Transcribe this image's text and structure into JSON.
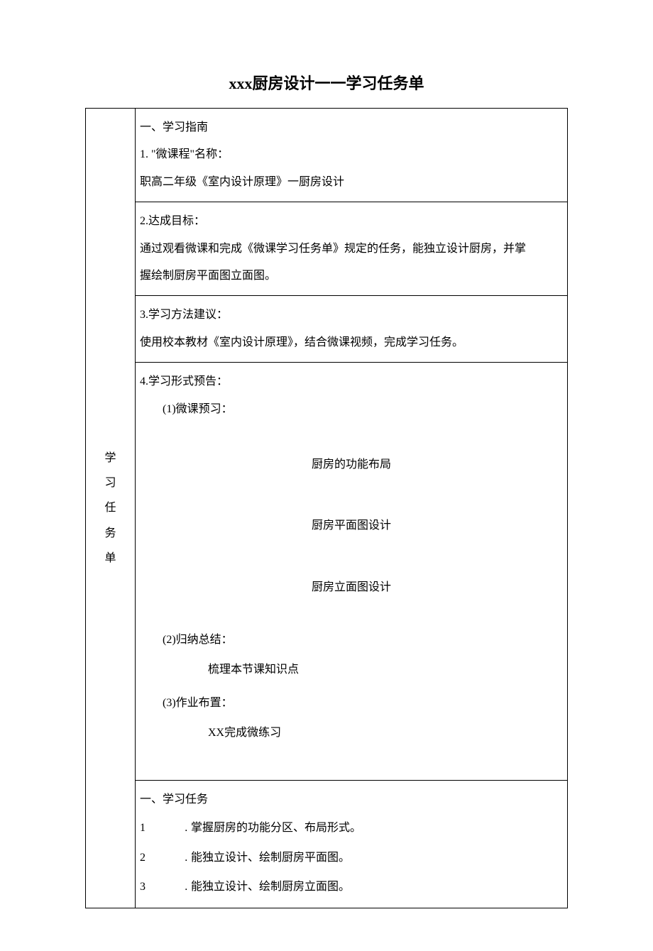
{
  "title": "xxx厨房设计一一学习任务单",
  "leftLabel": {
    "c1": "学",
    "c2": "习",
    "c3": "任",
    "c4": "务",
    "c5": "单"
  },
  "guide": {
    "heading": "一、学习指南",
    "item1_label": "1. \"微课程\"名称：",
    "item1_body": "职高二年级《室内设计原理》一厨房设计",
    "item2_label": "2.达成目标：",
    "item2_body_l1": "通过观看微课和完成《微课学习任务单》规定的任务，能独立设计厨房，并掌",
    "item2_body_l2": "握绘制厨房平面图立面图。",
    "item3_label": "3.学习方法建议：",
    "item3_body": "使用校本教材《室内设计原理》，结合微课视频，完成学习任务。",
    "item4_label": "4.学习形式预告：",
    "preview_label": "(1)微课预习：",
    "preview_a": "厨房的功能布局",
    "preview_b": "厨房平面图设计",
    "preview_c": "厨房立面图设计",
    "summary_label": "(2)归纳总结：",
    "summary_body": "梳理本节课知识点",
    "hw_label": "(3)作业布置：",
    "hw_body": "XX完成微练习"
  },
  "tasks": {
    "heading": "一、学习任务",
    "items": [
      {
        "n": "1",
        "dot": ".",
        "text": "掌握厨房的功能分区、布局形式。"
      },
      {
        "n": "2",
        "dot": ".",
        "text": "能独立设计、绘制厨房平面图。"
      },
      {
        "n": "3",
        "dot": ".",
        "text": "能独立设计、绘制厨房立面图。"
      }
    ]
  }
}
